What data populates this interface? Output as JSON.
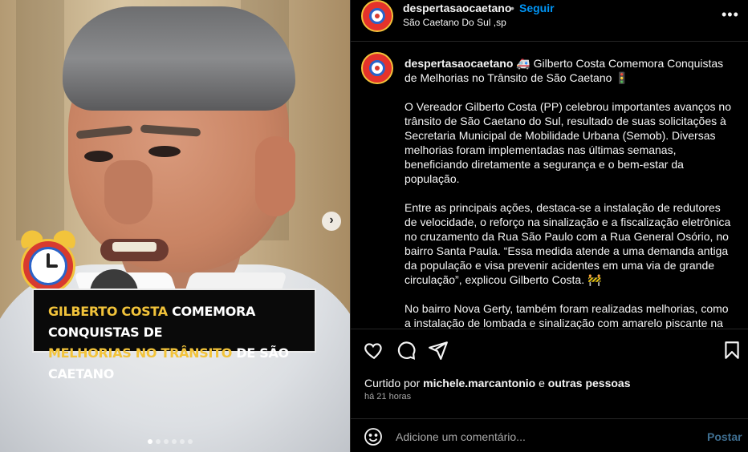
{
  "media": {
    "caption_line1_yellow": "GILBERTO COSTA",
    "caption_line1_white": "COMEMORA CONQUISTAS DE",
    "caption_line2_yellow": "MELHORIAS NO TRÂNSITO",
    "caption_line2_white": "DE SÃO CAETANO",
    "next_icon": "›",
    "carousel_dots": 6,
    "active_dot": 0
  },
  "header": {
    "username": "despertasaocaetano",
    "separator": "•",
    "follow_label": "Seguir",
    "location": "São Caetano Do Sul ,sp",
    "more_icon": "•••"
  },
  "post": {
    "username": "despertasaocaetano",
    "paragraphs": [
      "🚑 Gilberto Costa Comemora Conquistas de Melhorias no Trânsito de São Caetano 🚦",
      "O Vereador Gilberto Costa (PP) celebrou importantes avanços no trânsito de São Caetano do Sul, resultado de suas solicitações à Secretaria Municipal de Mobilidade Urbana (Semob). Diversas melhorias foram implementadas nas últimas semanas, beneficiando diretamente a segurança e o bem-estar da população.",
      "Entre as principais ações, destaca-se a instalação de redutores de velocidade, o reforço na sinalização e a fiscalização eletrônica no cruzamento da Rua São Paulo com a Rua General Osório, no bairro Santa Paula. “Essa medida atende a uma demanda antiga da população e visa prevenir acidentes em uma via de grande circulação”, explicou Gilberto Costa. 🚧",
      "No bairro Nova Gerty, também foram realizadas melhorias, como a instalação de lombada e sinalização com amarelo piscante na"
    ]
  },
  "actions": {
    "like_icon": "heart-icon",
    "comment_icon": "comment-icon",
    "share_icon": "share-icon",
    "save_icon": "bookmark-icon"
  },
  "likes": {
    "prefix": "Curtido por",
    "user": "michele.marcantonio",
    "middle": "e",
    "others": "outras pessoas"
  },
  "time_ago": "há 21 horas",
  "comment_box": {
    "placeholder": "Adicione um comentário...",
    "post_label": "Postar"
  },
  "colors": {
    "accent": "#0095f6",
    "caption_yellow": "#f2c33a",
    "post_disabled": "#3f6f91"
  }
}
